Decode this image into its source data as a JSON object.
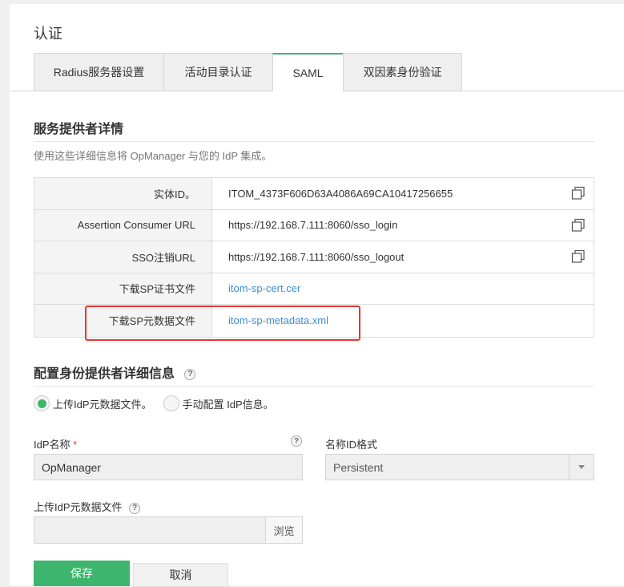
{
  "page": {
    "title": "认证"
  },
  "tabs": [
    {
      "label": "Radius服务器设置",
      "active": false
    },
    {
      "label": "活动目录认证",
      "active": false
    },
    {
      "label": "SAML",
      "active": true
    },
    {
      "label": "双因素身份验证",
      "active": false
    }
  ],
  "sp_details": {
    "title": "服务提供者详情",
    "description": "使用这些详细信息将 OpManager 与您的 IdP 集成。",
    "rows": [
      {
        "label": "实体ID。",
        "value": "ITOM_4373F606D63A4086A69CA10417256655",
        "copy_icon": "copy-icon"
      },
      {
        "label": "Assertion Consumer URL",
        "value": "https://192.168.7.111:8060/sso_login",
        "copy_icon": "copy-icon"
      },
      {
        "label": "SSO注销URL",
        "value": "https://192.168.7.111:8060/sso_logout",
        "copy_icon": "copy-icon"
      },
      {
        "label": "下载SP证书文件",
        "link": "itom-sp-cert.cer"
      },
      {
        "label": "下载SP元数据文件",
        "link": "itom-sp-metadata.xml"
      }
    ]
  },
  "idp_config": {
    "title": "配置身份提供者详细信息",
    "help_icon": "question-circle-icon",
    "radio_options": [
      {
        "label": "上传IdP元数据文件。",
        "checked": true
      },
      {
        "label": "手动配置 IdP信息。",
        "checked": false
      }
    ],
    "idp_name": {
      "label": "IdP名称",
      "required_mark": "*",
      "value": "OpManager"
    },
    "name_id_format": {
      "label": "名称ID格式",
      "selected": "Persistent"
    },
    "upload": {
      "label": "上传IdP元数据文件",
      "browse_label": "浏览"
    }
  },
  "actions": {
    "save_label": "保存",
    "cancel_label": "取消"
  },
  "colors": {
    "accent": "#3db56c",
    "link": "#3c8fd1",
    "highlight": "#e53935"
  }
}
